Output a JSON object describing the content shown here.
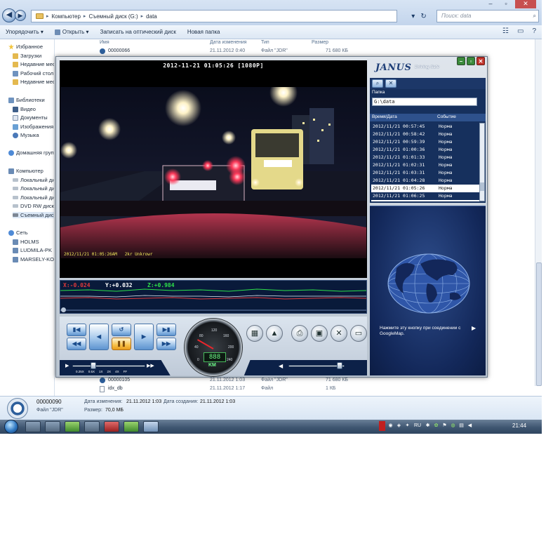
{
  "explorer": {
    "breadcrumb": [
      "Компьютер",
      "Съемный диск (G:)",
      "data"
    ],
    "search_placeholder": "Поиск: data",
    "toolbar": {
      "organize": "Упорядочить ▾",
      "open": "Открыть ▾",
      "burn": "Записать на оптический диск",
      "new_folder": "Новая папка"
    },
    "nav": {
      "favorites": "Избранное",
      "downloads": "Загрузки",
      "recent": "Недавние мес",
      "desktop": "Рабочий стол",
      "recent2": "Недавние мес",
      "libraries": "Библиотеки",
      "video": "Видео",
      "documents": "Документы",
      "images": "Изображения",
      "music": "Музыка",
      "homegroup": "Домашняя груп",
      "computer": "Компьютер",
      "local1": "Локальный ди",
      "local2": "Локальный ди",
      "local3": "Локальный ди",
      "dvd": "DVD RW диско",
      "removable": "Съемный диск",
      "network": "Сеть",
      "net1": "HOLMS",
      "net2": "LUDMILA-PK",
      "net3": "MARSELY-KOM"
    },
    "columns": {
      "name": "Имя",
      "modified": "Дата изменения",
      "type": "Тип",
      "size": "Размер"
    },
    "files_top": [
      {
        "name": "00000066",
        "date": "21.11.2012 0:40",
        "type": "Файл \"JDR\"",
        "size": "71 680 КБ"
      }
    ],
    "files_bottom": [
      {
        "name": "00000105",
        "date": "21.11.2012 1:03",
        "type": "Файл \"JDR\"",
        "size": "71 680 КБ"
      },
      {
        "name": "idx_db",
        "date": "21.11.2012 1:17",
        "type": "Файл",
        "size": "1 КБ"
      }
    ],
    "details": {
      "name": "00000090",
      "type": "Файл \"JDR\"",
      "modified_label": "Дата изменения:",
      "modified_value": "21.11.2012 1:03",
      "created_label": "Дата создания:",
      "created_value": "21.11.2012 1:03",
      "size_label": "Размер:",
      "size_value": "70,0 МБ"
    },
    "clock": "21:44",
    "tray_lang": "RU"
  },
  "player": {
    "brand": "JANUS",
    "brand_sub": "Driving Safe",
    "video_header": "2012-11-21 01:05:26 [1080P]",
    "video_osd": "2012/11/21 01:05:26AM   2kr Unkrowr",
    "gsensor": {
      "x": "X:-0.024",
      "y": "Y:+0.032",
      "z": "Z:+0.984"
    },
    "folder_label": "Папка",
    "folder_path": "G:\\data",
    "list_headers": {
      "time": "Время/Дата",
      "event": "Событие"
    },
    "log": [
      {
        "time": "2012/11/21 00:57:45",
        "event": "Норма"
      },
      {
        "time": "2012/11/21 00:58:42",
        "event": "Норма"
      },
      {
        "time": "2012/11/21 00:59:39",
        "event": "Норма"
      },
      {
        "time": "2012/11/21 01:00:36",
        "event": "Норма"
      },
      {
        "time": "2012/11/21 01:01:33",
        "event": "Норма"
      },
      {
        "time": "2012/11/21 01:02:31",
        "event": "Норма"
      },
      {
        "time": "2012/11/21 01:03:31",
        "event": "Норма"
      },
      {
        "time": "2012/11/21 01:04:28",
        "event": "Норма"
      },
      {
        "time": "2012/11/21 01:05:26",
        "event": "Норма"
      },
      {
        "time": "2012/11/21 01:06:25",
        "event": "Норма"
      }
    ],
    "selected_log_index": 8,
    "map_note": "Нажмите эту кнопку при соединении с GoogleMap.",
    "speed_unit": "KM",
    "speed_display": "888",
    "speed_scale": [
      "0",
      "40",
      "80",
      "120",
      "160",
      "200",
      "240"
    ],
    "playback_speeds": [
      "0.25X",
      "0.5X",
      "1X",
      "2X",
      "4X",
      "FF"
    ],
    "colors": {
      "accent_dark": "#16305d",
      "gsensor_x": "#e03a3a",
      "gsensor_y": "#ffffff",
      "gsensor_z": "#2de04a"
    }
  }
}
